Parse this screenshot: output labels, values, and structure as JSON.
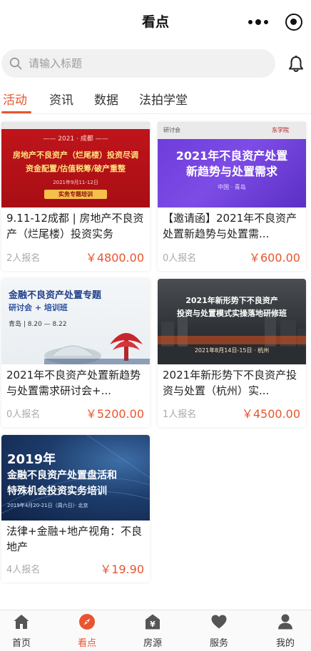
{
  "header": {
    "title": "看点"
  },
  "search": {
    "placeholder": "请输入标题"
  },
  "tabs": [
    {
      "label": "活动",
      "active": true
    },
    {
      "label": "资讯",
      "active": false
    },
    {
      "label": "数据",
      "active": false
    },
    {
      "label": "法拍学堂",
      "active": false
    }
  ],
  "cards": [
    {
      "title": "9.11-12成都 | 房地产不良资产（烂尾楼）投资实务",
      "count": "2人报名",
      "price": "￥4800.00",
      "thumb": {
        "line1": "—— 2021 · 成都 ——",
        "line2": "房地产不良资产（烂尾楼）投资尽调",
        "line3": "资金配置/估值税筹/破产重整",
        "line4": "2021年9月11-12日",
        "line5": "实务专题培训"
      }
    },
    {
      "title": "【邀请函】2021年不良资产处置新趋势与处置需...",
      "count": "0人报名",
      "price": "￥600.00",
      "thumb": {
        "tag": "研讨会",
        "brand": "东学院",
        "line1": "2021年不良资产处置",
        "line2": "新趋势与处置需求",
        "line3": "中国 · 青岛"
      }
    },
    {
      "title": "2021年不良资产处置新趋势与处置需求研讨会+...",
      "count": "0人报名",
      "price": "￥5200.00",
      "thumb": {
        "line1": "金融不良资产处置专题",
        "line2": "研讨会 + 培训班",
        "line3": "青岛 | 8.20 — 8.22"
      }
    },
    {
      "title": "2021年新形势下不良资产投资与处置（杭州）实...",
      "count": "1人报名",
      "price": "￥4500.00",
      "thumb": {
        "line1": "2021年新形势下不良资产",
        "line2": "投资与处置模式实操落地研修班",
        "line3": "2021年8月14日-15日 · 杭州"
      }
    },
    {
      "title": "法律+金融+地产视角：不良地产",
      "count": "4人报名",
      "price": "￥19.90",
      "thumb": {
        "line1": "2019年",
        "line2": "金融不良资产处置盘活和",
        "line3": "特殊机会投资实务培训",
        "line4": "2019年4月20-21日（周六日）· 北京"
      }
    }
  ],
  "bottom_nav": [
    {
      "label": "首页",
      "icon": "home-icon",
      "active": false
    },
    {
      "label": "看点",
      "icon": "compass-icon",
      "active": true
    },
    {
      "label": "房源",
      "icon": "house-yen-icon",
      "active": false
    },
    {
      "label": "服务",
      "icon": "heart-icon",
      "active": false
    },
    {
      "label": "我的",
      "icon": "user-icon",
      "active": false
    }
  ],
  "colors": {
    "accent": "#e8552f",
    "nav_icon": "#555555"
  }
}
